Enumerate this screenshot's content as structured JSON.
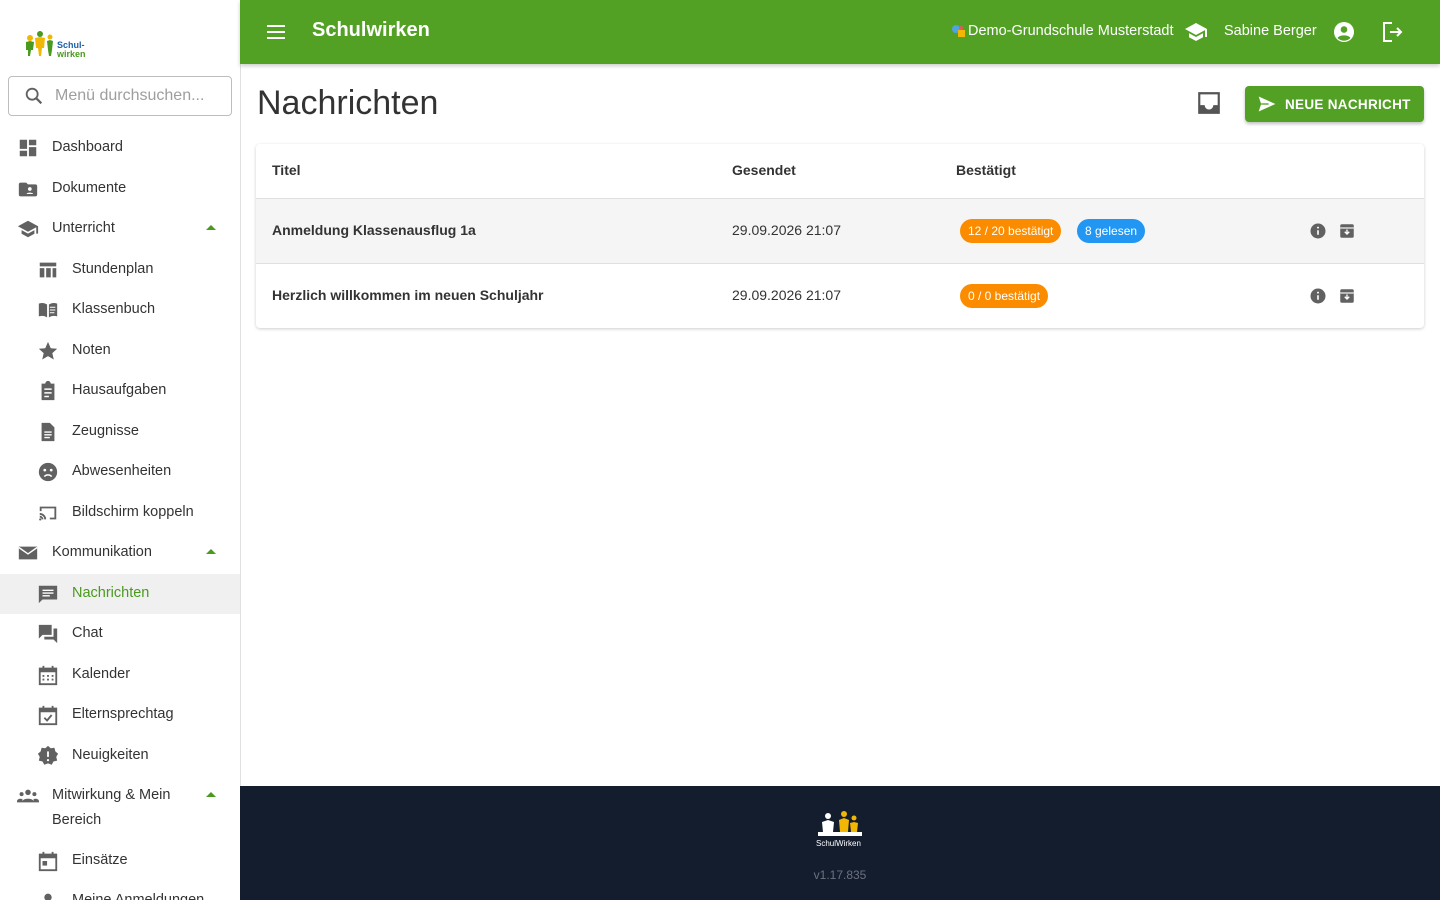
{
  "app": {
    "brand": "Schulwirken"
  },
  "header": {
    "school": "Demo-Grundschule Musterstadt",
    "user": "Sabine Berger"
  },
  "sidebar": {
    "logo_text": "Schul-wirken",
    "search_placeholder": "Menü durchsuchen...",
    "items": [
      {
        "label": "Dashboard",
        "icon": "dashboard-icon"
      },
      {
        "label": "Dokumente",
        "icon": "folder-account-icon"
      },
      {
        "label": "Unterricht",
        "icon": "school-icon"
      },
      {
        "label": "Stundenplan",
        "icon": "table-icon"
      },
      {
        "label": "Klassenbuch",
        "icon": "book-open-icon"
      },
      {
        "label": "Noten",
        "icon": "star-icon"
      },
      {
        "label": "Hausaufgaben",
        "icon": "clipboard-icon"
      },
      {
        "label": "Zeugnisse",
        "icon": "file-document-icon"
      },
      {
        "label": "Abwesenheiten",
        "icon": "face-sad-icon"
      },
      {
        "label": "Bildschirm koppeln",
        "icon": "cast-icon"
      },
      {
        "label": "Kommunikation",
        "icon": "mail-icon"
      },
      {
        "label": "Nachrichten",
        "icon": "message-text-icon"
      },
      {
        "label": "Chat",
        "icon": "forum-icon"
      },
      {
        "label": "Kalender",
        "icon": "calendar-icon"
      },
      {
        "label": "Elternsprechtag",
        "icon": "calendar-check-icon"
      },
      {
        "label": "Neuigkeiten",
        "icon": "alert-decagram-icon"
      },
      {
        "label": "Mitwirkung & Mein Bereich",
        "icon": "account-group-icon"
      },
      {
        "label": "Einsätze",
        "icon": "calendar-today-icon"
      },
      {
        "label": "Meine Anmeldungen",
        "icon": "account-icon"
      }
    ]
  },
  "main": {
    "title": "Nachrichten",
    "new_button": "NEUE NACHRICHT",
    "columns": [
      "Titel",
      "Gesendet",
      "Bestätigt"
    ],
    "rows": [
      {
        "title": "Anmeldung Klassenausflug 1a",
        "sent": "29.09.2026 21:07",
        "confirmed": "12 / 20 bestätigt",
        "read": "8 gelesen"
      },
      {
        "title": "Herzlich willkommen im neuen Schuljahr",
        "sent": "29.09.2026 21:07",
        "confirmed": "0 / 0 bestätigt"
      }
    ]
  },
  "footer": {
    "version": "v1.17.835",
    "logo_text": "SchulWirken"
  },
  "colors": {
    "primary": "#52a125",
    "footer_bg": "#141d2e",
    "chip_orange": "#fb8c00",
    "chip_blue": "#2196f3",
    "active_text": "#4a9a1f"
  }
}
